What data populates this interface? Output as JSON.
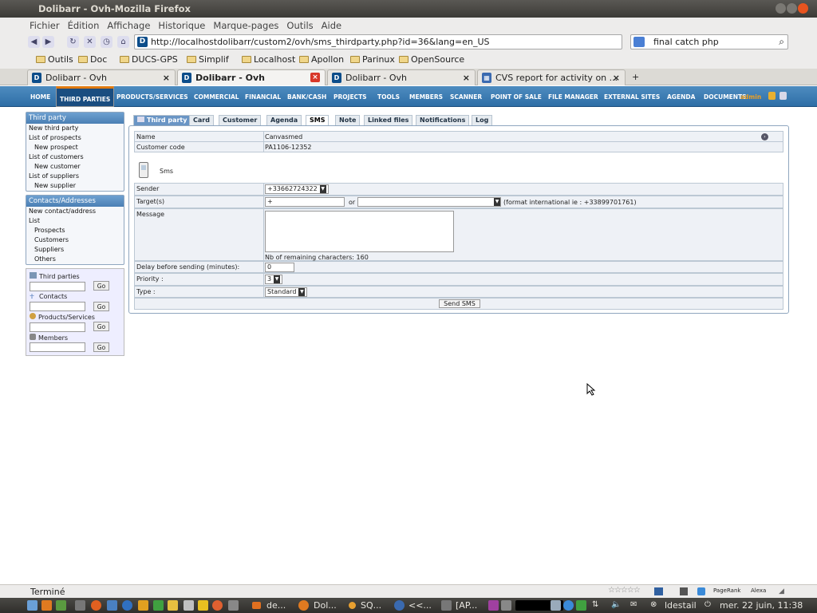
{
  "window": {
    "title": "Dolibarr - Ovh-Mozilla Firefox"
  },
  "menubar": [
    "Fichier",
    "Édition",
    "Affichage",
    "Historique",
    "Marque-pages",
    "Outils",
    "Aide"
  ],
  "nav": {
    "url": "http://localhostdolibarr/custom2/ovh/sms_thirdparty.php?id=36&lang=en_US",
    "search": "final catch php"
  },
  "bookmarks": [
    "Outils",
    "Doc",
    "DUCS-GPS",
    "Simplif",
    "Localhost",
    "Apollon",
    "Parinux",
    "OpenSource"
  ],
  "browser_tabs": [
    {
      "label": "Dolibarr - Ovh"
    },
    {
      "label": "Dolibarr - Ovh"
    },
    {
      "label": "Dolibarr - Ovh"
    },
    {
      "label": "CVS report for activity on ..."
    }
  ],
  "topmenu": [
    "HOME",
    "THIRD PARTIES",
    "PRODUCTS/SERVICES",
    "COMMERCIAL",
    "FINANCIAL",
    "BANK/CASH",
    "PROJECTS",
    "TOOLS",
    "MEMBERS",
    "SCANNER",
    "POINT OF SALE",
    "FILE MANAGER",
    "EXTERNAL SITES",
    "AGENDA",
    "DOCUMENTS"
  ],
  "user": "admin",
  "left": {
    "thirdparty": {
      "head": "Third party",
      "items": [
        "New third party",
        "List of prospects",
        "New prospect",
        "List of customers",
        "New customer",
        "List of suppliers",
        "New supplier"
      ]
    },
    "contacts": {
      "head": "Contacts/Addresses",
      "items": [
        "New contact/address",
        "List",
        "Prospects",
        "Customers",
        "Suppliers",
        "Others"
      ]
    },
    "search": [
      "Third parties",
      "Contacts",
      "Products/Services",
      "Members"
    ],
    "go": "Go"
  },
  "tabs": [
    "Third party",
    "Card",
    "Customer",
    "Agenda",
    "SMS",
    "Note",
    "Linked files",
    "Notifications",
    "Log"
  ],
  "thirdparty": {
    "name_label": "Name",
    "name": "Canvasmed",
    "code_label": "Customer code",
    "code": "PA1106-12352"
  },
  "sms": {
    "title": "Sms",
    "sender_label": "Sender",
    "sender": "+33662724322",
    "target_label": "Target(s)",
    "target_value": "+",
    "or": "or",
    "format_hint": "(format international ie : +33899701761)",
    "message_label": "Message",
    "remaining": "Nb of remaining characters: 160",
    "delay_label": "Delay before sending (minutes):",
    "delay": "0",
    "priority_label": "Priority :",
    "priority": "3",
    "type_label": "Type :",
    "type": "Standard",
    "send": "Send SMS"
  },
  "status": {
    "text": "Terminé",
    "pagerank": "PageRank",
    "alexa": "Alexa"
  },
  "taskbar": {
    "items": [
      "de...",
      "Dol...",
      "SQ...",
      "<<...",
      "[AP..."
    ],
    "user": "ldestail",
    "clock": "mer. 22 juin, 11:38"
  }
}
